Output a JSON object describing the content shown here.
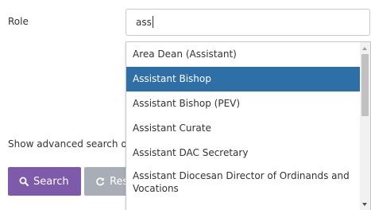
{
  "form": {
    "role_label": "Role",
    "role_value": "ass",
    "advanced_link": "Show advanced search o",
    "search_label": "Search",
    "reset_label": "Res"
  },
  "dropdown": {
    "options": [
      "Area Dean (Assistant)",
      "Assistant Bishop",
      "Assistant Bishop (PEV)",
      "Assistant Curate",
      "Assistant DAC Secretary",
      "Assistant Diocesan Director of Ordinands and Vocations"
    ],
    "selected_option": "Assistant Bishop"
  },
  "colors": {
    "search_button": "#7e5baa",
    "reset_button": "#a9aeb6",
    "selected_option": "#2f6fa8"
  },
  "icons": {
    "search_button": "search-icon",
    "reset_button": "refresh-icon"
  }
}
